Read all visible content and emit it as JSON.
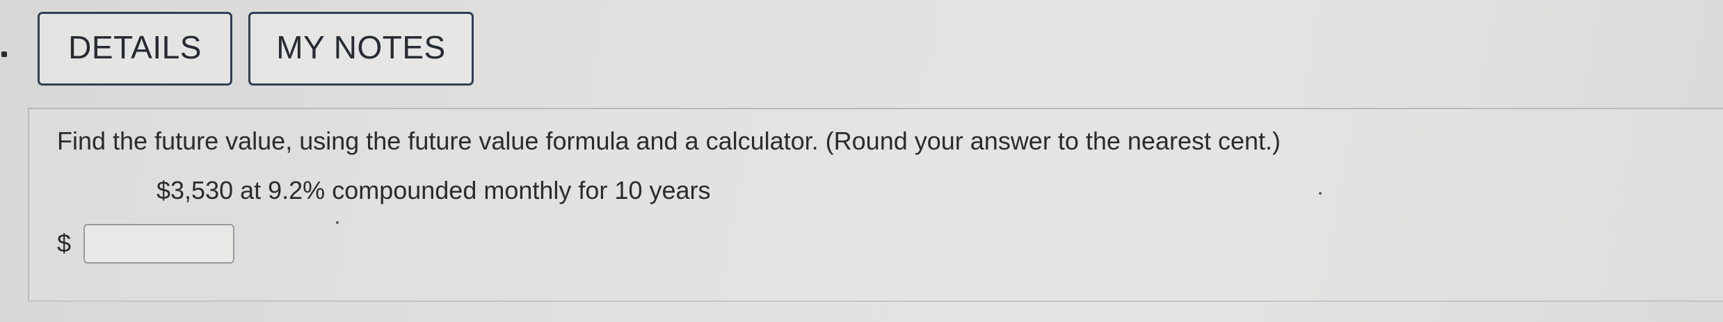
{
  "tabs": {
    "details_label": "DETAILS",
    "notes_label": "MY NOTES"
  },
  "question": {
    "prompt": "Find the future value, using the future value formula and a calculator. (Round your answer to the nearest cent.)",
    "problem": "$3,530 at 9.2% compounded monthly for 10 years",
    "currency_symbol": "$",
    "answer_value": "",
    "answer_placeholder": ""
  },
  "colors": {
    "tab_border": "#2d3f55",
    "text": "#2b2b2b",
    "background": "#e0e0df"
  }
}
